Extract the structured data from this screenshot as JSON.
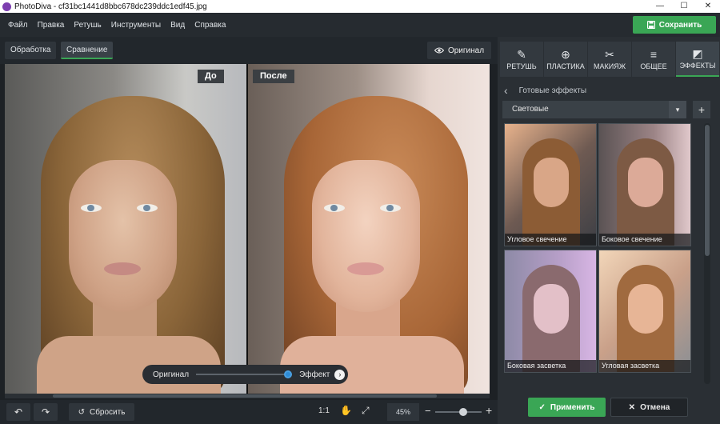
{
  "window": {
    "title": "PhotoDiva - cf31bc1441d8bbc678dc239ddc1edf45.jpg",
    "controls": [
      "—",
      "☐",
      "✕"
    ]
  },
  "menu": {
    "items": [
      "Файл",
      "Правка",
      "Ретушь",
      "Инструменты",
      "Вид",
      "Справка"
    ]
  },
  "save_button": {
    "label": "Сохранить",
    "icon": "floppy-disk-icon"
  },
  "mode_tabs": [
    {
      "label": "Обработка",
      "active": false
    },
    {
      "label": "Сравнение",
      "active": true
    }
  ],
  "original_button": {
    "label": "Оригинал",
    "icon": "eye-icon"
  },
  "comparison": {
    "before_label": "До",
    "after_label": "После"
  },
  "effect_slider": {
    "left_label": "Оригинал",
    "right_label": "Эффект",
    "value": 1.0
  },
  "bottom_toolbar": {
    "undo_icon": "undo-icon",
    "redo_icon": "redo-icon",
    "reset_label": "Сбросить",
    "ratio_label": "1:1",
    "zoom_value": "45%",
    "zoom_minus": "−",
    "zoom_plus": "+",
    "zoom_level": 0.5
  },
  "panel": {
    "tabs": [
      {
        "label": "РЕТУШЬ",
        "icon": "✎",
        "active": false
      },
      {
        "label": "ПЛАСТИКА",
        "icon": "⊕",
        "active": false
      },
      {
        "label": "МАКИЯЖ",
        "icon": "✂",
        "active": false
      },
      {
        "label": "ОБЩЕЕ",
        "icon": "≡",
        "active": false
      },
      {
        "label": "ЭФФЕКТЫ",
        "icon": "◩",
        "active": true
      }
    ],
    "back_icon": "‹",
    "header": "Готовые эффекты",
    "category": "Световые",
    "add_label": "+",
    "effects": [
      {
        "label": "Угловое свечение",
        "tint": "#b8735a"
      },
      {
        "label": "Боковое свечение",
        "tint": "#c48a80"
      },
      {
        "label": "Боковая засветка",
        "tint": "#9a7ab3"
      },
      {
        "label": "Угловая засветка",
        "tint": "#c99060"
      }
    ],
    "apply_label": "Применить",
    "cancel_label": "Отмена",
    "colors": {
      "accent": "#3aa655",
      "slider": "#2d8bd6"
    }
  }
}
